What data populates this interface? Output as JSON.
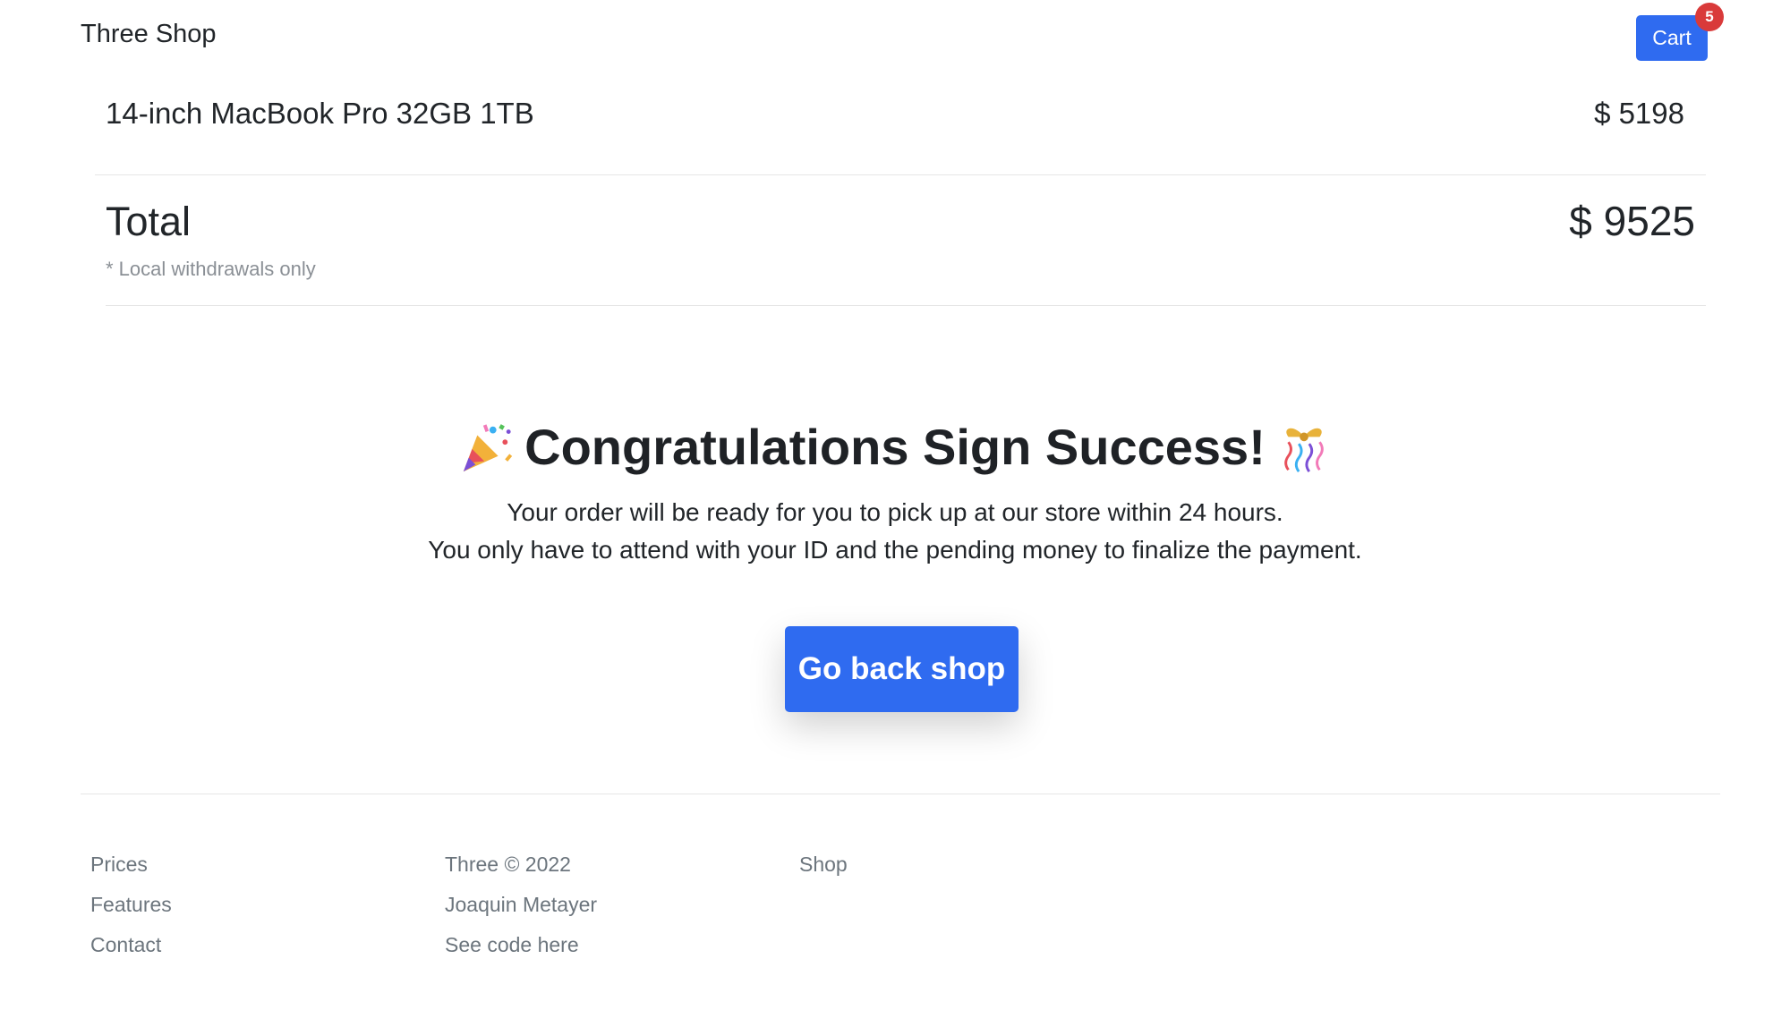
{
  "header": {
    "brand": "Three Shop",
    "cart_label": "Cart",
    "cart_count": "5",
    "primary_color": "#2f6bf0",
    "badge_color": "#d93a3a"
  },
  "order": {
    "item": {
      "name": "14-inch MacBook Pro 32GB 1TB",
      "price": "$ 5198"
    },
    "total_label": "Total",
    "total_value": "$ 9525",
    "note": "* Local withdrawals only"
  },
  "success": {
    "title": "Congratulations Sign Success!",
    "icon_left": "party-popper-icon",
    "icon_right": "wrapped-gift-icon",
    "line1": "Your order will be ready for you to pick up at our store within 24 hours.",
    "line2": "You only have to attend with your ID and the pending money to finalize the payment.",
    "button": "Go back shop"
  },
  "footer": {
    "col1": [
      "Prices",
      "Features",
      "Contact"
    ],
    "col2": [
      "Three © 2022",
      "Joaquin Metayer",
      "See code here"
    ],
    "col3": [
      "Shop"
    ]
  }
}
